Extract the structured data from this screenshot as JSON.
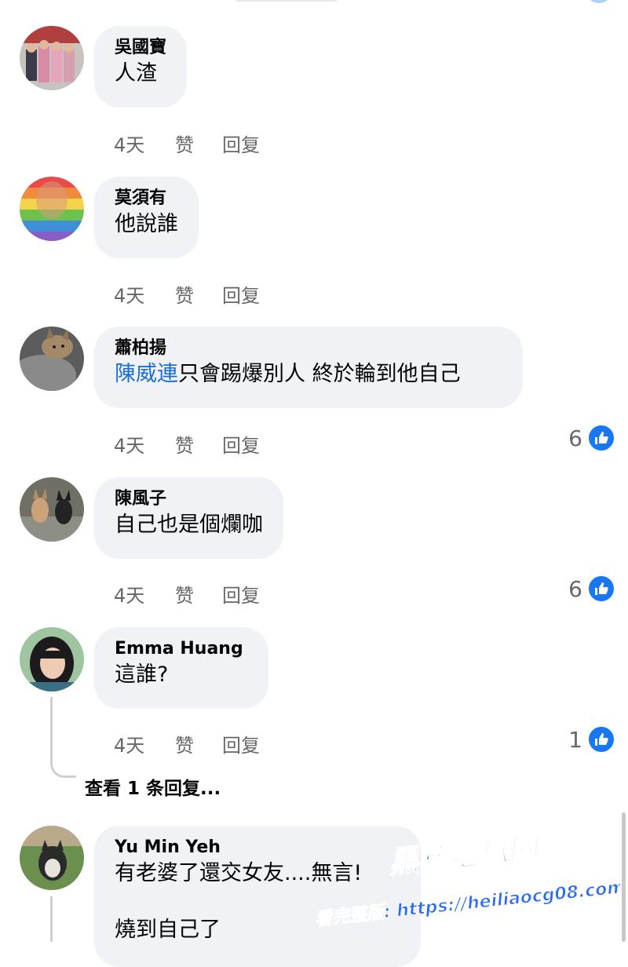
{
  "comments": [
    {
      "author": "吳國寶",
      "text": "人渣",
      "time": "4天",
      "like_label": "赞",
      "reply_label": "回复",
      "reactions": ""
    },
    {
      "author": "莫須有",
      "text": "他說誰",
      "time": "4天",
      "like_label": "赞",
      "reply_label": "回复",
      "reactions": ""
    },
    {
      "author": "蕭柏揚",
      "mention": "陳威連",
      "text": "只會踢爆別人 終於輪到他自己",
      "time": "4天",
      "like_label": "赞",
      "reply_label": "回复",
      "reactions": "6"
    },
    {
      "author": "陳風子",
      "text": "自己也是個爛咖",
      "time": "4天",
      "like_label": "赞",
      "reply_label": "回复",
      "reactions": "6"
    },
    {
      "author": "Emma Huang",
      "text": "這誰?",
      "time": "4天",
      "like_label": "赞",
      "reply_label": "回复",
      "reactions": "1"
    },
    {
      "author": "Yu Min Yeh",
      "text": "有老婆了還交女友....無言!",
      "text2": "燒到自己了"
    }
  ],
  "view_replies": "查看 1 条回复...",
  "watermark": {
    "title": "黑料吃瓜网",
    "line": "看完整版: https://heiliaocg08.com"
  },
  "colors": {
    "bubble": "#f0f2f5",
    "like_blue": "#1877f2",
    "mention": "#1a6fd6",
    "meta_gray": "#65676b"
  }
}
